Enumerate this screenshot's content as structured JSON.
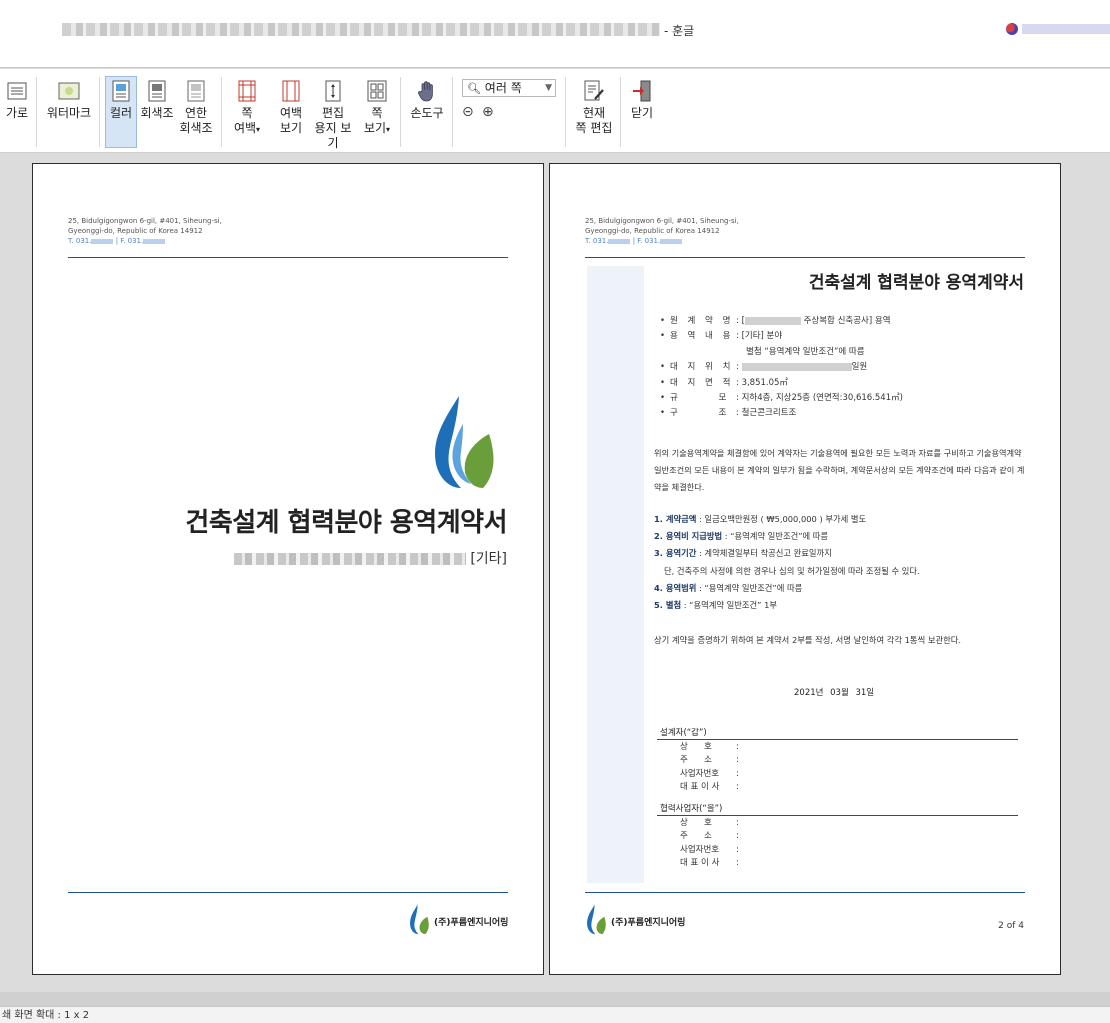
{
  "window": {
    "app_suffix": "- 훈글"
  },
  "ribbon": {
    "items": [
      {
        "label": "가로",
        "icon": "landscape-page-icon"
      },
      {
        "label": "워터마크",
        "icon": "watermark-icon"
      },
      {
        "label": "컬러",
        "icon": "color-print-icon",
        "active": true
      },
      {
        "label": "회색조",
        "icon": "grayscale-icon"
      },
      {
        "label": "연한\n회색조",
        "icon": "light-grayscale-icon"
      },
      {
        "label": "쪽\n여백",
        "icon": "page-margin-icon",
        "dropdown": true
      },
      {
        "label": "여백\n보기",
        "icon": "margin-view-icon"
      },
      {
        "label": "편집\n용지 보기",
        "icon": "edit-paper-view-icon"
      },
      {
        "label": "쪽\n보기",
        "icon": "page-view-icon",
        "dropdown": true
      },
      {
        "label": "손도구",
        "icon": "hand-tool-icon"
      },
      {
        "label": "현재\n쪽 편집",
        "icon": "edit-current-page-icon"
      },
      {
        "label": "닫기",
        "icon": "close-preview-icon"
      }
    ],
    "view_mode": {
      "value": "여러 쪽",
      "icon": "magnifier-icon"
    },
    "zoom_out_icon": "zoom-out-icon",
    "zoom_in_icon": "zoom-in-icon"
  },
  "page1": {
    "address_line1": "25, Bidulgigongwon 6-gil, #401, Siheung-si,",
    "address_line2": "Gyeonggi-do, Republic of Korea 14912",
    "address_line3": "T. 031.",
    "title": "건축설계 협력분야 용역계약서",
    "subtitle_tag": "[기타]",
    "company": "(주)푸름엔지니어링"
  },
  "page2": {
    "address_line1": "25, Bidulgigongwon 6-gil, #401, Siheung-si,",
    "address_line2": "Gyeonggi-do, Republic of Korea 14912",
    "address_line3": "T. 031.",
    "title": "건축설계 협력분야 용역계약서",
    "info": [
      {
        "label": "원 계 약 명",
        "value_suffix": "주상복합 신축공사] 용역",
        "value_prefix": ": ["
      },
      {
        "label": "용 역 내 용",
        "value": ": [기타] 분야"
      },
      {
        "label": "",
        "value": "별첨 “용역계약 일반조건”에 따름",
        "indent": true
      },
      {
        "label": "대 지 위 치",
        "value_prefix": ": ",
        "value_suffix": "일원"
      },
      {
        "label": "대 지 면 적",
        "value": ": 3,851.05㎡"
      },
      {
        "label": "규      모",
        "value": ": 지하4층, 지상25층 (연면적:30,616.541㎡)"
      },
      {
        "label": "구      조",
        "value": ": 철근콘크리트조"
      }
    ],
    "paragraph": "위의 기술용역계약을 체결함에 있어 계약자는 기술용역에 필요한 모든 노력과 자료를 구비하고 기술용역계약일반조건의 모든 내용이 본 계약의 일부가 됨을 수락하며, 계약문서상의 모든 계약조건에 따라 다음과 같이 계약을 체결한다.",
    "terms": [
      {
        "num": "1. 계약금액",
        "text": " : 일금오백만원정 ( ₩5,000,000 ) 부가세 별도"
      },
      {
        "num": "2. 용역비 지급방법",
        "text": " : “용역계약 일반조건”에 따름"
      },
      {
        "num": "3. 용역기간",
        "text": " : 계약체결일부터 착공신고 완료일까지"
      },
      {
        "num": "",
        "text": "   단, 건축주의 사정에 의한 경우나 심의 및 허가일정에 따라 조정될 수 있다."
      },
      {
        "num": "4. 용역범위",
        "text": " : “용역계약 일반조건”에 따름"
      },
      {
        "num": "5. 별첨",
        "text": " : “용역계약 일반조건” 1부"
      }
    ],
    "pledge": "상기 계약을 증명하기 위하여 본 계약서 2부를 작성, 서명 날인하여 각각 1통씩 보관한다.",
    "date": "2021년  03월  31일",
    "party_a": {
      "heading": "설계자(“갑”)",
      "fields": [
        "상      호",
        "주      소",
        "사업자번호",
        "대 표 이 사"
      ]
    },
    "party_b": {
      "heading": "협력사업자(“을”)",
      "fields": [
        "상      호",
        "주      소",
        "사업자번호",
        "대 표 이 사"
      ]
    },
    "company": "(주)푸름엔지니어링",
    "page_number": "2 of 4"
  },
  "status": {
    "zoom_text": "쇄 화면 확대 : 1 x 2"
  },
  "colors": {
    "rule": "#1c4f8c",
    "active_ribbon": "#d6e5f5",
    "logo_blue": "#1f6fb8",
    "logo_green": "#6a9e3a"
  }
}
